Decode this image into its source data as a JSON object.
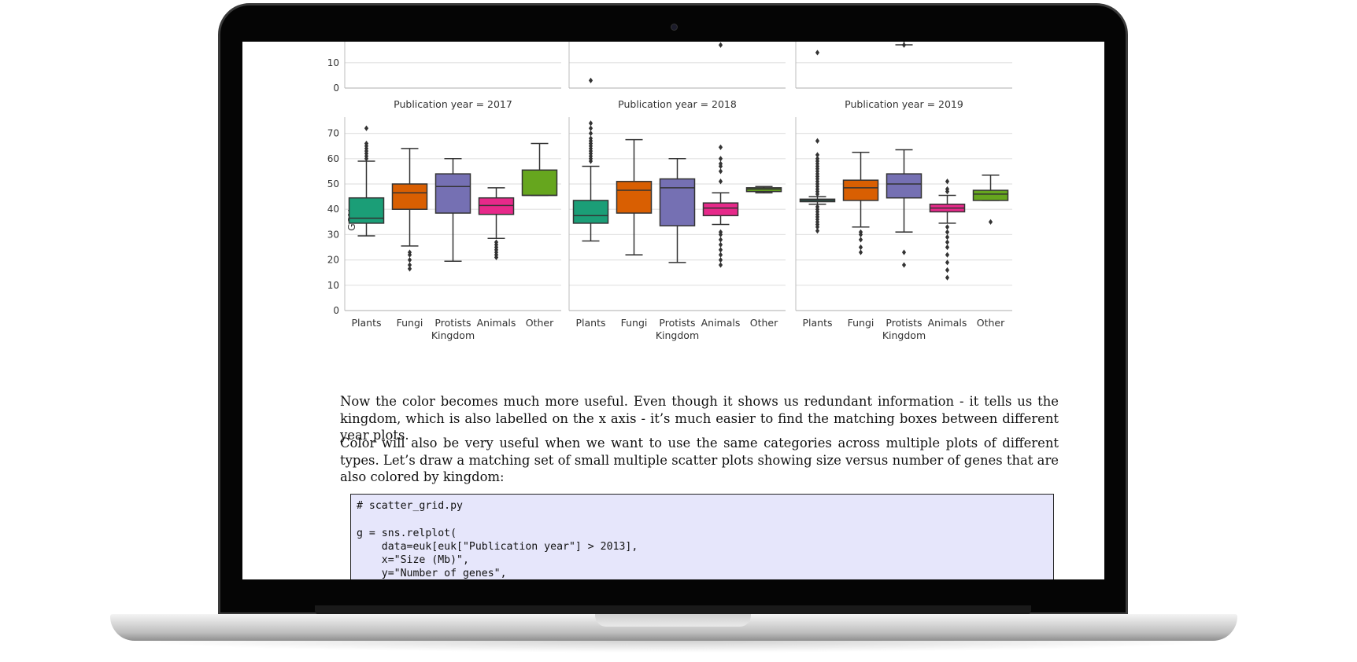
{
  "document": {
    "paragraph_1": "Now the color becomes much more useful. Even though it shows us redundant information - it tells us the kingdom, which is also labelled on the x axis - it’s much easier to find the matching boxes between different year plots.",
    "paragraph_2": "Color will also be very useful when we want to use the same categories across multiple plots of different types. Let’s draw a matching set of small multiple scatter plots showing size versus number of genes that are also colored by kingdom:",
    "code_lines": [
      "# scatter_grid.py",
      "",
      "g = sns.relplot(",
      "    data=euk[euk[\"Publication year\"] > 2013],",
      "    x=\"Size (Mb)\",",
      "    y=\"Number of genes\","
    ]
  },
  "chart_data": {
    "type": "box",
    "ylabel": "GC%",
    "xlabel": "Kingdom",
    "categories": [
      "Plants",
      "Fungi",
      "Protists",
      "Animals",
      "Other"
    ],
    "yticks": [
      0,
      10,
      20,
      30,
      40,
      50,
      60,
      70
    ],
    "ylim": [
      0,
      77
    ],
    "colors": {
      "Plants": "#1b9e77",
      "Fungi": "#d95f02",
      "Protists": "#7570b3",
      "Animals": "#e7298a",
      "Other": "#66a61e"
    },
    "top_row_visible_yticks": [
      0,
      10
    ],
    "top_row_outliers": [
      {
        "panel": 1,
        "category": "Plants",
        "value": 3
      },
      {
        "panel": 1,
        "category": "Animals",
        "value": 17
      },
      {
        "panel": 2,
        "category": "Plants",
        "value": 14
      },
      {
        "panel": 2,
        "category": "Protists",
        "value": 17
      }
    ],
    "panels": [
      {
        "title": "Publication year = 2017",
        "boxes": [
          {
            "category": "Plants",
            "whisker_low": 29.5,
            "q1": 34.5,
            "median": 36.5,
            "q3": 44.5,
            "whisker_high": 59,
            "outliers": [
              60,
              61,
              62,
              63,
              64,
              65,
              66,
              72
            ]
          },
          {
            "category": "Fungi",
            "whisker_low": 25.5,
            "q1": 40,
            "median": 46.5,
            "q3": 50,
            "whisker_high": 64,
            "outliers": [
              16.5,
              18,
              20,
              22,
              23
            ]
          },
          {
            "category": "Protists",
            "whisker_low": 19.5,
            "q1": 38.5,
            "median": 49,
            "q3": 54,
            "whisker_high": 60,
            "outliers": []
          },
          {
            "category": "Animals",
            "whisker_low": 28.5,
            "q1": 38,
            "median": 41.5,
            "q3": 44.5,
            "whisker_high": 48.5,
            "outliers": [
              21,
              22,
              23,
              24,
              25,
              26,
              27
            ]
          },
          {
            "category": "Other",
            "whisker_low": 45.5,
            "q1": 45.5,
            "median": 45.5,
            "q3": 55.5,
            "whisker_high": 66,
            "outliers": []
          }
        ]
      },
      {
        "title": "Publication year = 2018",
        "boxes": [
          {
            "category": "Plants",
            "whisker_low": 27.5,
            "q1": 34.5,
            "median": 37.5,
            "q3": 43.5,
            "whisker_high": 57,
            "outliers": [
              59,
              60,
              61,
              62,
              63,
              64,
              65,
              66,
              67,
              68,
              70,
              72,
              74
            ]
          },
          {
            "category": "Fungi",
            "whisker_low": 22,
            "q1": 38.5,
            "median": 47.5,
            "q3": 51,
            "whisker_high": 67.5,
            "outliers": []
          },
          {
            "category": "Protists",
            "whisker_low": 19,
            "q1": 33.5,
            "median": 48.5,
            "q3": 52,
            "whisker_high": 60,
            "outliers": []
          },
          {
            "category": "Animals",
            "whisker_low": 34,
            "q1": 37.5,
            "median": 40.5,
            "q3": 42.5,
            "whisker_high": 46.5,
            "outliers": [
              18,
              20,
              22,
              24,
              26,
              28,
              30,
              31,
              51,
              55,
              57,
              58,
              60,
              64.5
            ]
          },
          {
            "category": "Other",
            "whisker_low": 46.5,
            "q1": 47,
            "median": 48,
            "q3": 48.5,
            "whisker_high": 49,
            "outliers": []
          }
        ]
      },
      {
        "title": "Publication year = 2019",
        "boxes": [
          {
            "category": "Plants",
            "whisker_low": 42,
            "q1": 43,
            "median": 43.5,
            "q3": 44,
            "whisker_high": 45,
            "outliers": [
              31.5,
              33,
              34,
              35,
              36,
              37,
              38,
              39,
              40,
              41,
              46,
              47,
              48,
              49,
              50,
              51,
              52,
              53,
              54,
              55,
              56,
              57,
              58,
              59,
              60,
              61.5,
              67
            ]
          },
          {
            "category": "Fungi",
            "whisker_low": 33,
            "q1": 43.5,
            "median": 48.5,
            "q3": 51.5,
            "whisker_high": 62.5,
            "outliers": [
              23,
              25,
              28,
              30,
              31
            ]
          },
          {
            "category": "Protists",
            "whisker_low": 31,
            "q1": 44.5,
            "median": 50,
            "q3": 54,
            "whisker_high": 63.5,
            "outliers": [
              18,
              23
            ]
          },
          {
            "category": "Animals",
            "whisker_low": 34.5,
            "q1": 39,
            "median": 40.5,
            "q3": 42,
            "whisker_high": 45.5,
            "outliers": [
              13,
              16,
              19,
              22,
              25,
              27,
              29,
              31,
              33,
              47,
              48,
              51
            ]
          },
          {
            "category": "Other",
            "whisker_low": 43.5,
            "q1": 43.5,
            "median": 46,
            "q3": 47.5,
            "whisker_high": 53.5,
            "outliers": [
              35
            ]
          }
        ]
      }
    ]
  }
}
